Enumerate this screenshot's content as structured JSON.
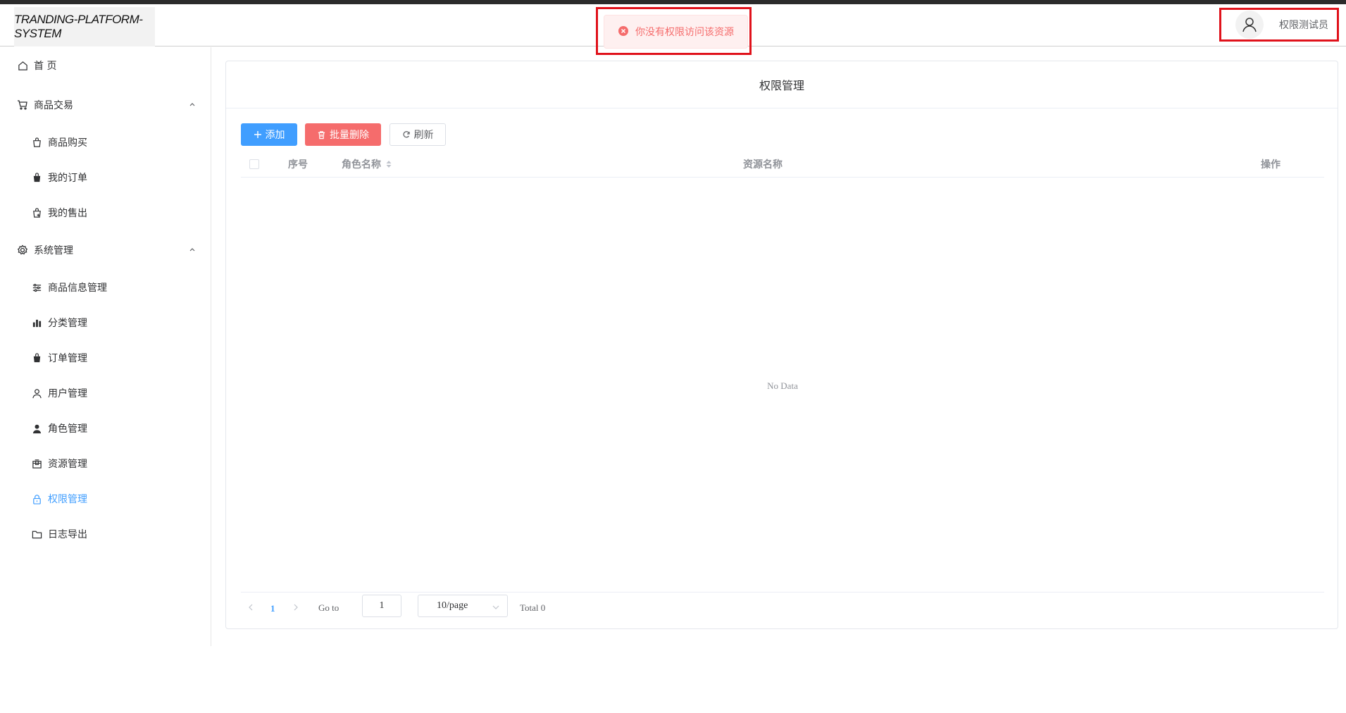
{
  "header": {
    "logo_text": "TRANDING-PLATFORM-SYSTEM",
    "user_name": "权限测试员",
    "user_icon": "user-icon"
  },
  "toast": {
    "message": "你没有权限访问该资源",
    "icon": "error-circle-icon",
    "color": "#f56c6c"
  },
  "sidebar": {
    "active_color": "#409eff",
    "home": {
      "label": "首 页",
      "icon": "home-icon"
    },
    "trade": {
      "label": "商品交易",
      "icon": "cart-icon",
      "items": [
        {
          "label": "商品购买",
          "icon": "shopping-bag-icon"
        },
        {
          "label": "我的订单",
          "icon": "bag-filled-icon"
        },
        {
          "label": "我的售出",
          "icon": "sold-icon"
        }
      ]
    },
    "system": {
      "label": "系统管理",
      "icon": "gear-icon",
      "items": [
        {
          "label": "商品信息管理",
          "icon": "sliders-icon"
        },
        {
          "label": "分类管理",
          "icon": "bar-chart-icon"
        },
        {
          "label": "订单管理",
          "icon": "bag-filled-icon"
        },
        {
          "label": "用户管理",
          "icon": "user-icon"
        },
        {
          "label": "角色管理",
          "icon": "user-filled-icon"
        },
        {
          "label": "资源管理",
          "icon": "box-icon"
        },
        {
          "label": "权限管理",
          "icon": "lock-icon",
          "active": true
        },
        {
          "label": "日志导出",
          "icon": "folder-icon"
        }
      ]
    }
  },
  "main": {
    "title": "权限管理",
    "buttons": {
      "add": "添加",
      "batch_delete": "批量删除",
      "refresh": "刷新"
    },
    "table": {
      "columns": [
        "序号",
        "角色名称",
        "资源名称",
        "操作"
      ],
      "rows": [],
      "empty_text": "No Data"
    },
    "pagination": {
      "current_page": "1",
      "goto_label": "Go to",
      "goto_value": "1",
      "page_size": "10/page",
      "total_text": "Total 0"
    }
  }
}
